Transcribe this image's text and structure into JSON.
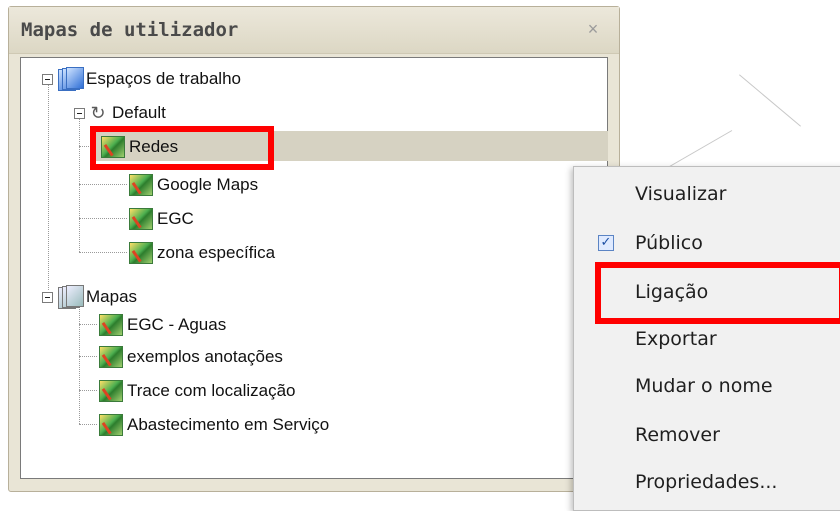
{
  "window": {
    "title": "Mapas de utilizador",
    "close_symbol": "×"
  },
  "tree": {
    "workspaces": {
      "label": "Espaços de trabalho",
      "icon": "workspace-icon",
      "default": {
        "label": "Default",
        "icon": "default-icon",
        "children": [
          {
            "label": "Redes",
            "selected": true
          },
          {
            "label": "Google Maps"
          },
          {
            "label": "EGC"
          },
          {
            "label": "zona específica"
          }
        ]
      }
    },
    "maps": {
      "label": "Mapas",
      "icon": "maps-folder-icon",
      "children": [
        {
          "label": "EGC - Aguas"
        },
        {
          "label": "exemplos anotações"
        },
        {
          "label": "Trace com localização"
        },
        {
          "label": "Abastecimento em Serviço"
        }
      ]
    }
  },
  "context_menu": {
    "items": [
      {
        "label": "Visualizar"
      },
      {
        "label": "Público",
        "checked": true,
        "check_symbol": "✓"
      },
      {
        "label": "Ligação",
        "highlighted": true
      },
      {
        "label": "Exportar"
      },
      {
        "label": "Mudar o nome"
      },
      {
        "label": "Remover"
      },
      {
        "label": "Propriedades..."
      }
    ]
  },
  "colors": {
    "highlight_box": "#ff0000",
    "selected_row": "#d6d2c2",
    "window_bg": "#e9e5d6"
  }
}
